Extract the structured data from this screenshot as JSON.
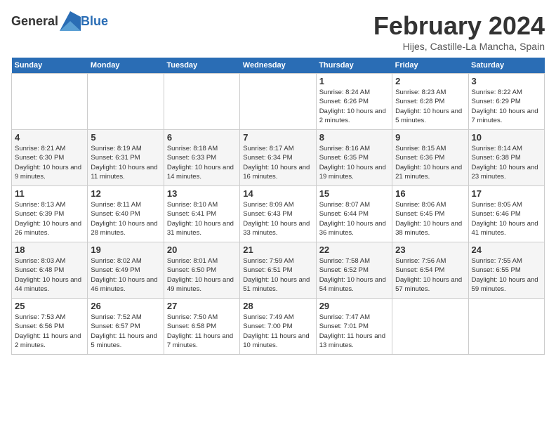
{
  "header": {
    "logo_general": "General",
    "logo_blue": "Blue",
    "title": "February 2024",
    "subtitle": "Hijes, Castille-La Mancha, Spain"
  },
  "calendar": {
    "days_of_week": [
      "Sunday",
      "Monday",
      "Tuesday",
      "Wednesday",
      "Thursday",
      "Friday",
      "Saturday"
    ],
    "weeks": [
      [
        {
          "day": "",
          "info": ""
        },
        {
          "day": "",
          "info": ""
        },
        {
          "day": "",
          "info": ""
        },
        {
          "day": "",
          "info": ""
        },
        {
          "day": "1",
          "info": "Sunrise: 8:24 AM\nSunset: 6:26 PM\nDaylight: 10 hours and 2 minutes."
        },
        {
          "day": "2",
          "info": "Sunrise: 8:23 AM\nSunset: 6:28 PM\nDaylight: 10 hours and 5 minutes."
        },
        {
          "day": "3",
          "info": "Sunrise: 8:22 AM\nSunset: 6:29 PM\nDaylight: 10 hours and 7 minutes."
        }
      ],
      [
        {
          "day": "4",
          "info": "Sunrise: 8:21 AM\nSunset: 6:30 PM\nDaylight: 10 hours and 9 minutes."
        },
        {
          "day": "5",
          "info": "Sunrise: 8:19 AM\nSunset: 6:31 PM\nDaylight: 10 hours and 11 minutes."
        },
        {
          "day": "6",
          "info": "Sunrise: 8:18 AM\nSunset: 6:33 PM\nDaylight: 10 hours and 14 minutes."
        },
        {
          "day": "7",
          "info": "Sunrise: 8:17 AM\nSunset: 6:34 PM\nDaylight: 10 hours and 16 minutes."
        },
        {
          "day": "8",
          "info": "Sunrise: 8:16 AM\nSunset: 6:35 PM\nDaylight: 10 hours and 19 minutes."
        },
        {
          "day": "9",
          "info": "Sunrise: 8:15 AM\nSunset: 6:36 PM\nDaylight: 10 hours and 21 minutes."
        },
        {
          "day": "10",
          "info": "Sunrise: 8:14 AM\nSunset: 6:38 PM\nDaylight: 10 hours and 23 minutes."
        }
      ],
      [
        {
          "day": "11",
          "info": "Sunrise: 8:13 AM\nSunset: 6:39 PM\nDaylight: 10 hours and 26 minutes."
        },
        {
          "day": "12",
          "info": "Sunrise: 8:11 AM\nSunset: 6:40 PM\nDaylight: 10 hours and 28 minutes."
        },
        {
          "day": "13",
          "info": "Sunrise: 8:10 AM\nSunset: 6:41 PM\nDaylight: 10 hours and 31 minutes."
        },
        {
          "day": "14",
          "info": "Sunrise: 8:09 AM\nSunset: 6:43 PM\nDaylight: 10 hours and 33 minutes."
        },
        {
          "day": "15",
          "info": "Sunrise: 8:07 AM\nSunset: 6:44 PM\nDaylight: 10 hours and 36 minutes."
        },
        {
          "day": "16",
          "info": "Sunrise: 8:06 AM\nSunset: 6:45 PM\nDaylight: 10 hours and 38 minutes."
        },
        {
          "day": "17",
          "info": "Sunrise: 8:05 AM\nSunset: 6:46 PM\nDaylight: 10 hours and 41 minutes."
        }
      ],
      [
        {
          "day": "18",
          "info": "Sunrise: 8:03 AM\nSunset: 6:48 PM\nDaylight: 10 hours and 44 minutes."
        },
        {
          "day": "19",
          "info": "Sunrise: 8:02 AM\nSunset: 6:49 PM\nDaylight: 10 hours and 46 minutes."
        },
        {
          "day": "20",
          "info": "Sunrise: 8:01 AM\nSunset: 6:50 PM\nDaylight: 10 hours and 49 minutes."
        },
        {
          "day": "21",
          "info": "Sunrise: 7:59 AM\nSunset: 6:51 PM\nDaylight: 10 hours and 51 minutes."
        },
        {
          "day": "22",
          "info": "Sunrise: 7:58 AM\nSunset: 6:52 PM\nDaylight: 10 hours and 54 minutes."
        },
        {
          "day": "23",
          "info": "Sunrise: 7:56 AM\nSunset: 6:54 PM\nDaylight: 10 hours and 57 minutes."
        },
        {
          "day": "24",
          "info": "Sunrise: 7:55 AM\nSunset: 6:55 PM\nDaylight: 10 hours and 59 minutes."
        }
      ],
      [
        {
          "day": "25",
          "info": "Sunrise: 7:53 AM\nSunset: 6:56 PM\nDaylight: 11 hours and 2 minutes."
        },
        {
          "day": "26",
          "info": "Sunrise: 7:52 AM\nSunset: 6:57 PM\nDaylight: 11 hours and 5 minutes."
        },
        {
          "day": "27",
          "info": "Sunrise: 7:50 AM\nSunset: 6:58 PM\nDaylight: 11 hours and 7 minutes."
        },
        {
          "day": "28",
          "info": "Sunrise: 7:49 AM\nSunset: 7:00 PM\nDaylight: 11 hours and 10 minutes."
        },
        {
          "day": "29",
          "info": "Sunrise: 7:47 AM\nSunset: 7:01 PM\nDaylight: 11 hours and 13 minutes."
        },
        {
          "day": "",
          "info": ""
        },
        {
          "day": "",
          "info": ""
        }
      ]
    ]
  }
}
